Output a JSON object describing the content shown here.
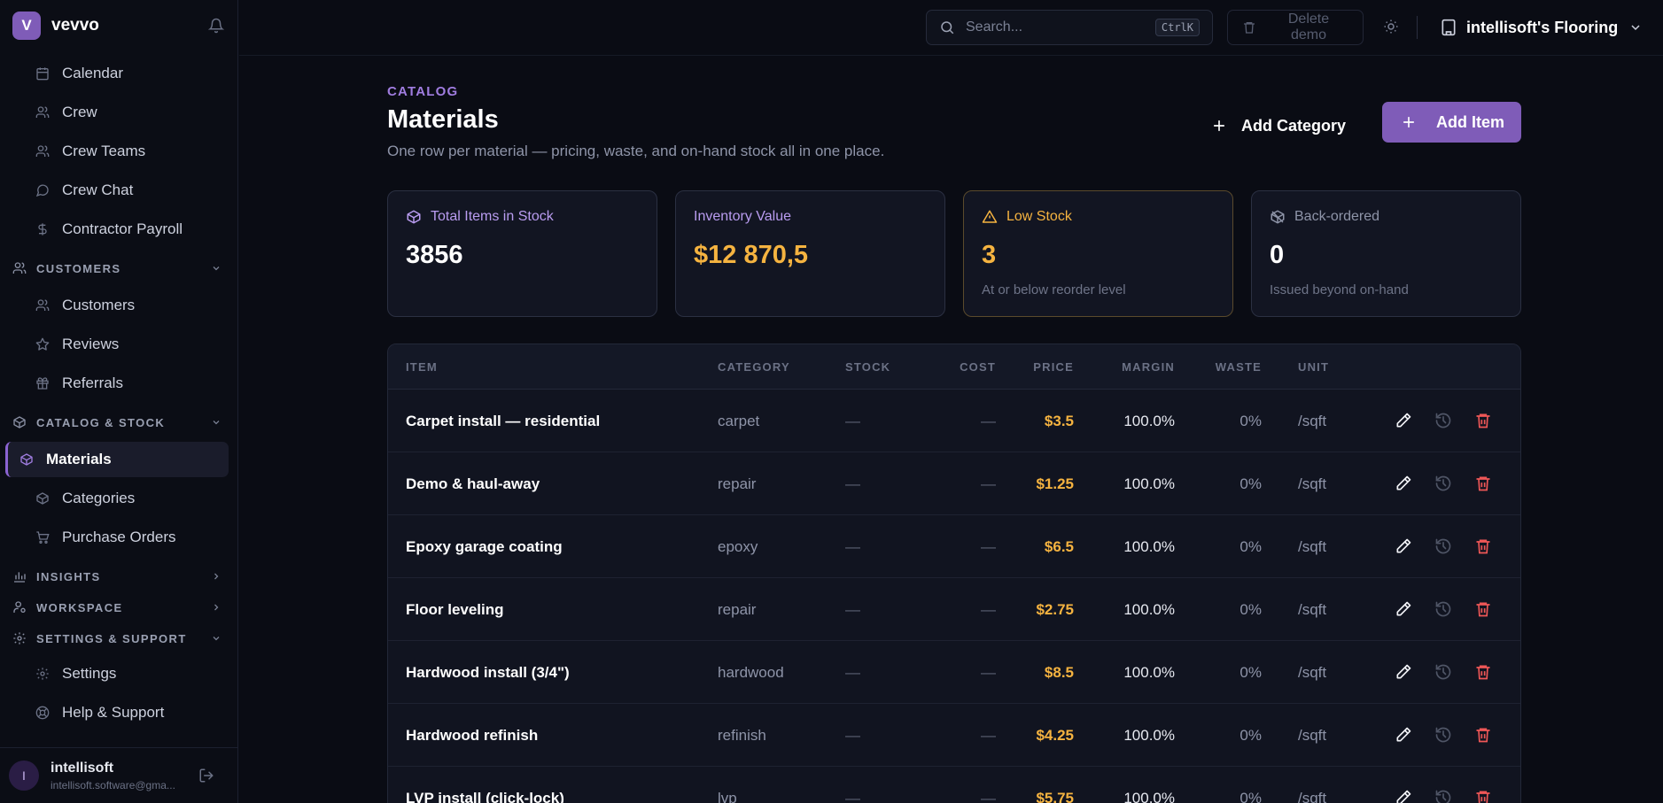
{
  "app": {
    "logo_letter": "V",
    "name": "vevvo"
  },
  "sidebar": {
    "items_top": [
      {
        "label": "Calendar",
        "icon": "calendar-icon"
      },
      {
        "label": "Crew",
        "icon": "users-icon"
      },
      {
        "label": "Crew Teams",
        "icon": "users-icon"
      },
      {
        "label": "Crew Chat",
        "icon": "chat-icon"
      },
      {
        "label": "Contractor Payroll",
        "icon": "dollar-icon"
      }
    ],
    "sections": {
      "customers": {
        "label": "CUSTOMERS",
        "items": [
          "Customers",
          "Reviews",
          "Referrals"
        ]
      },
      "catalog": {
        "label": "CATALOG & STOCK",
        "items": [
          "Materials",
          "Categories",
          "Purchase Orders"
        ]
      },
      "insights": {
        "label": "INSIGHTS"
      },
      "workspace": {
        "label": "WORKSPACE"
      },
      "settings": {
        "label": "SETTINGS & SUPPORT",
        "items": [
          "Settings",
          "Help & Support"
        ]
      }
    },
    "user": {
      "initial": "I",
      "name": "intellisoft",
      "email": "intellisoft.software@gma..."
    }
  },
  "topbar": {
    "search_placeholder": "Search...",
    "search_shortcut": "CtrlK",
    "delete_demo": "Delete demo",
    "org_name": "intellisoft's Flooring"
  },
  "page": {
    "eyebrow": "CATALOG",
    "title": "Materials",
    "subtitle": "One row per material — pricing, waste, and on-hand stock all in one place.",
    "add_category": "Add Category",
    "add_item": "Add Item"
  },
  "cards": [
    {
      "label": "Total Items in Stock",
      "value": "3856",
      "sub": "",
      "color": "#b99cf0"
    },
    {
      "label": "Inventory Value",
      "value": "$12 870,5",
      "sub": "",
      "color": "#b99cf0"
    },
    {
      "label": "Low Stock",
      "value": "3",
      "sub": "At or below reorder level",
      "color": "#f5b340"
    },
    {
      "label": "Back-ordered",
      "value": "0",
      "sub": "Issued beyond on-hand",
      "color": "#8e94a8"
    }
  ],
  "table": {
    "headers": {
      "item": "ITEM",
      "category": "CATEGORY",
      "stock": "STOCK",
      "cost": "COST",
      "price": "PRICE",
      "margin": "MARGIN",
      "waste": "WASTE",
      "unit": "UNIT"
    },
    "rows": [
      {
        "name": "Carpet install — residential",
        "category": "carpet",
        "stock": "—",
        "cost": "—",
        "price": "$3.5",
        "margin": "100.0%",
        "waste": "0%",
        "unit": "/sqft"
      },
      {
        "name": "Demo & haul-away",
        "category": "repair",
        "stock": "—",
        "cost": "—",
        "price": "$1.25",
        "margin": "100.0%",
        "waste": "0%",
        "unit": "/sqft"
      },
      {
        "name": "Epoxy garage coating",
        "category": "epoxy",
        "stock": "—",
        "cost": "—",
        "price": "$6.5",
        "margin": "100.0%",
        "waste": "0%",
        "unit": "/sqft"
      },
      {
        "name": "Floor leveling",
        "category": "repair",
        "stock": "—",
        "cost": "—",
        "price": "$2.75",
        "margin": "100.0%",
        "waste": "0%",
        "unit": "/sqft"
      },
      {
        "name": "Hardwood install (3/4\")",
        "category": "hardwood",
        "stock": "—",
        "cost": "—",
        "price": "$8.5",
        "margin": "100.0%",
        "waste": "0%",
        "unit": "/sqft"
      },
      {
        "name": "Hardwood refinish",
        "category": "refinish",
        "stock": "—",
        "cost": "—",
        "price": "$4.25",
        "margin": "100.0%",
        "waste": "0%",
        "unit": "/sqft"
      },
      {
        "name": "LVP install (click-lock)",
        "category": "lvp",
        "stock": "—",
        "cost": "—",
        "price": "$5.75",
        "margin": "100.0%",
        "waste": "0%",
        "unit": "/sqft"
      }
    ]
  },
  "colors": {
    "accent": "#7f5cb8",
    "price": "#f5b340",
    "danger": "#ef5757",
    "background": "#0a0c14"
  }
}
